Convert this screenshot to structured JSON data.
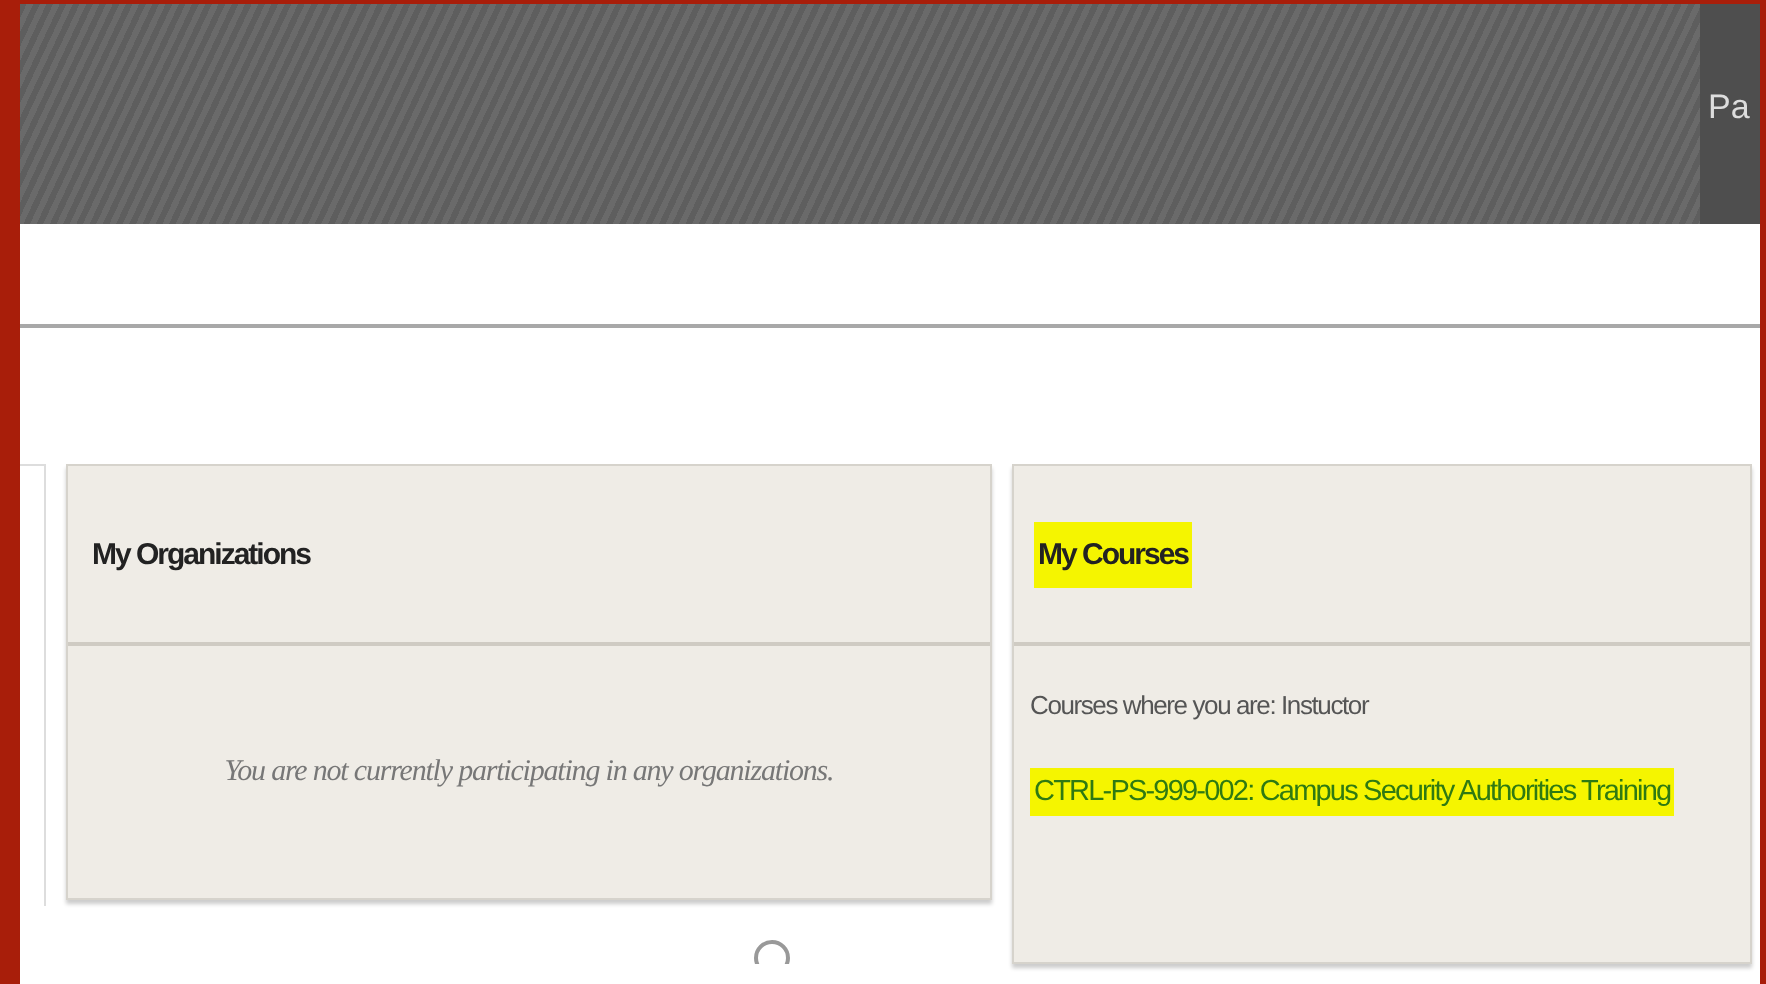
{
  "header": {
    "tab_label": "Pa"
  },
  "organizations": {
    "title": "My Organizations",
    "empty_message": "You are not currently participating in any organizations."
  },
  "courses": {
    "title": "My Courses",
    "title_highlighted": true,
    "role_label": "Courses where you are: Instuctor",
    "items": [
      {
        "label": "CTRL-PS-999-002: Campus Security Authorities Training",
        "highlighted": true
      }
    ]
  }
}
